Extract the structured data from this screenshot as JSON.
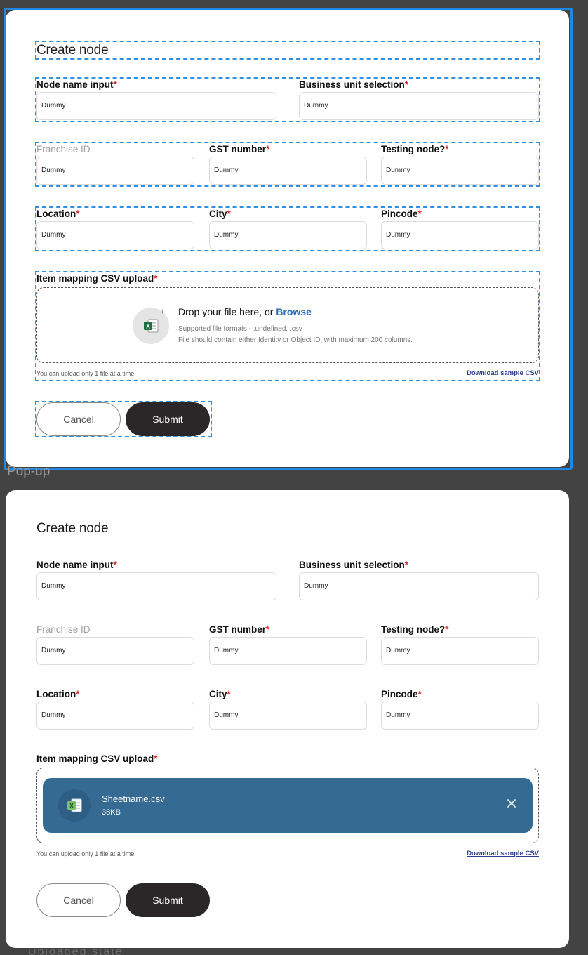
{
  "frame_label": "Pop-up",
  "bottom_ghost": "Uploaded state",
  "form": {
    "title": "Create node",
    "fields": {
      "node_name": {
        "label": "Node name input",
        "value": "Dummy",
        "required": true
      },
      "business_unit": {
        "label": "Business unit selection",
        "value": "Dummy",
        "required": true
      },
      "franchise_id": {
        "label": "Franchise ID",
        "value": "Dummy",
        "required": false
      },
      "gst": {
        "label": "GST number",
        "value": "Dummy",
        "required": true
      },
      "testing_node": {
        "label": "Testing node?",
        "value": "Dummy",
        "required": true
      },
      "location": {
        "label": "Location",
        "value": "Dummy",
        "required": true
      },
      "city": {
        "label": "City",
        "value": "Dummy",
        "required": true
      },
      "pincode": {
        "label": "Pincode",
        "value": "Dummy",
        "required": true
      }
    },
    "required_mark": "*",
    "upload": {
      "label": "Item mapping CSV upload",
      "drop_text": "Drop your file here, or ",
      "browse": "Browse",
      "formats": "Supported file formats - .undefined, .csv",
      "constraint": "File should contain either Identity or Object ID, with maximum 200 columns.",
      "hint": "You can upload only 1 file at a time.",
      "download": "Download sample CSV",
      "uploaded_file": {
        "name": "Sheetname.csv",
        "size": "38KB"
      }
    },
    "buttons": {
      "cancel": "Cancel",
      "submit": "Submit"
    }
  },
  "colors": {
    "accent_selection": "#1e88e5",
    "required": "#e02424",
    "browse_link": "#2a6cb5",
    "file_chip": "#356a93",
    "submit_bg": "#2b2628",
    "canvas_bg": "#434343"
  },
  "icons": [
    "excel-file-icon",
    "upload-arrow-icon",
    "close-icon"
  ]
}
